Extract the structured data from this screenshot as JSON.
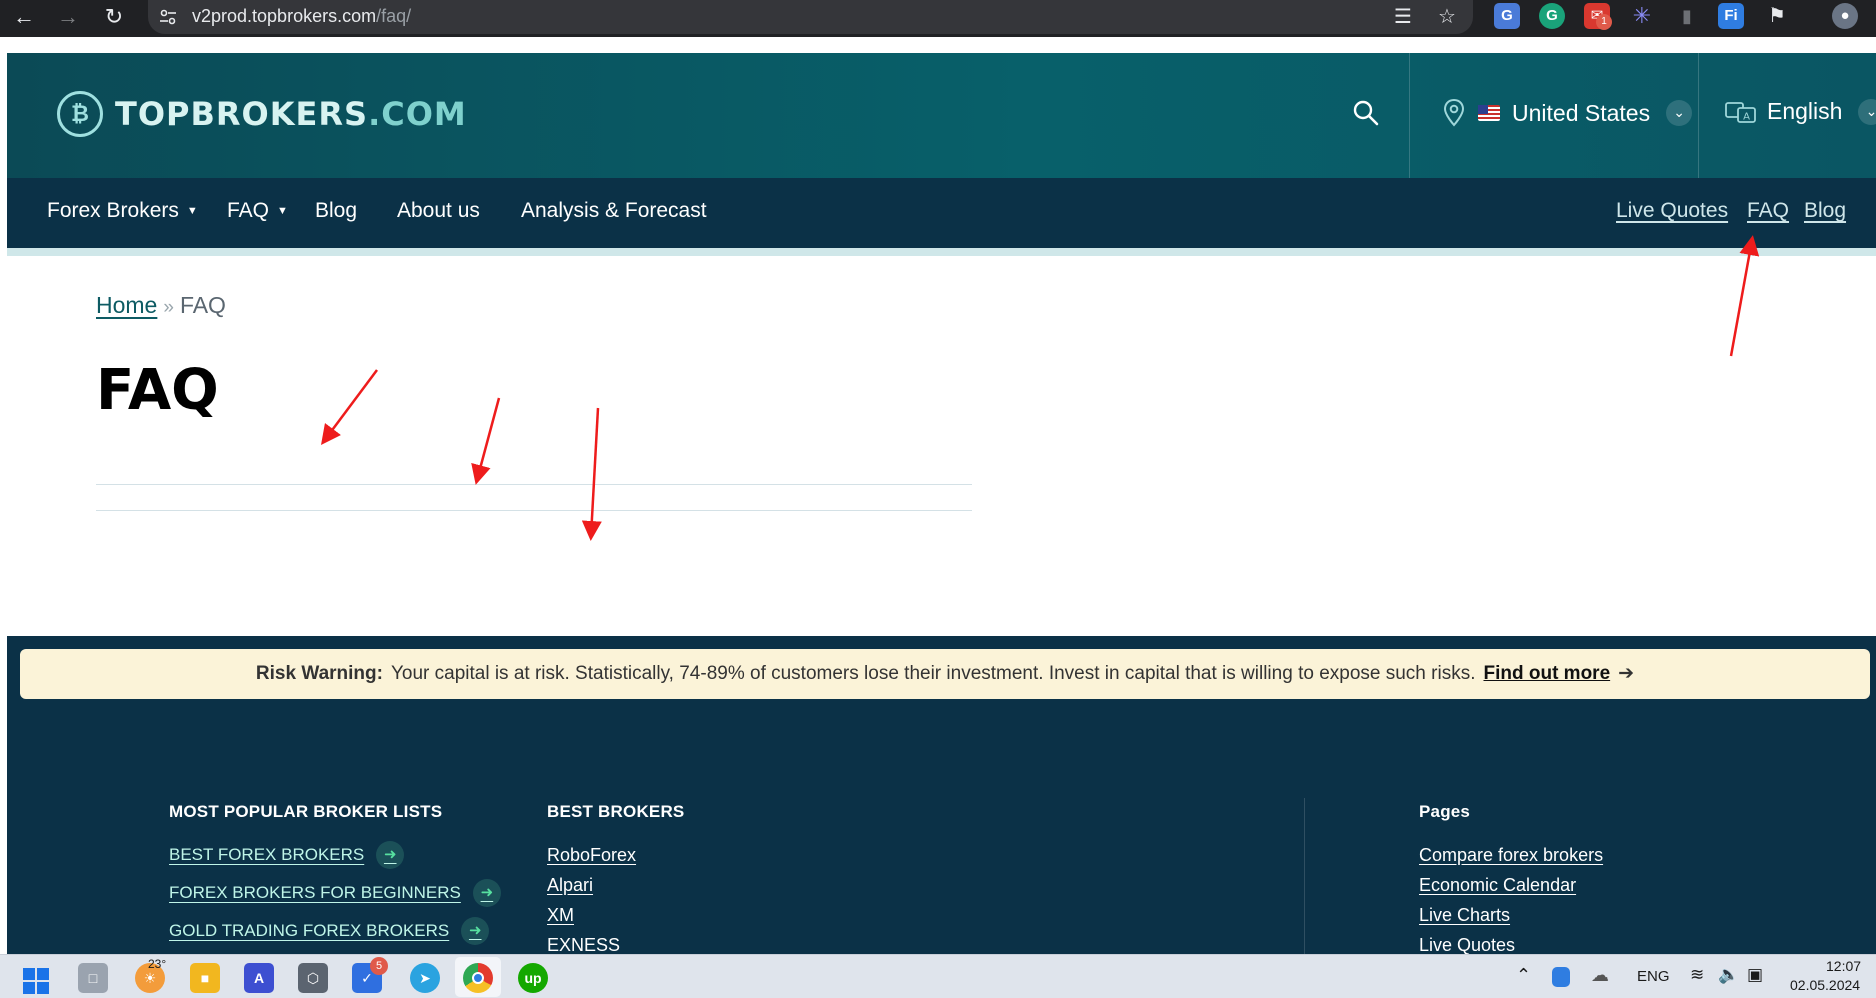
{
  "browser": {
    "url_host": "v2prod.topbrokers.com",
    "url_path": "/faq/",
    "extension_badge": "1"
  },
  "header": {
    "logo_mark": "₿",
    "logo_text_main": "TOPBROKERS",
    "logo_text_domain": ".COM",
    "country": "United States",
    "language": "English",
    "brand_color": "#0b4a56"
  },
  "nav": {
    "items": [
      {
        "label": "Forex Brokers",
        "has_dropdown": true
      },
      {
        "label": "FAQ",
        "has_dropdown": true
      },
      {
        "label": "Blog",
        "has_dropdown": false
      },
      {
        "label": "About us",
        "has_dropdown": false
      },
      {
        "label": "Analysis & Forecast",
        "has_dropdown": false
      }
    ],
    "right_links": [
      "Live Quotes",
      "FAQ",
      "Blog"
    ]
  },
  "breadcrumb": {
    "home": "Home",
    "separator": "»",
    "current": "FAQ"
  },
  "page": {
    "title": "FAQ"
  },
  "footer": {
    "risk": {
      "label": "Risk Warning:",
      "text": "Your capital is at risk. Statistically, 74-89% of customers lose their investment. Invest in capital that is willing to expose such risks.",
      "link": "Find out more",
      "arrow": "➔"
    },
    "popular": {
      "title": "MOST POPULAR BROKER LISTS",
      "items": [
        "BEST FOREX BROKERS",
        "FOREX BROKERS FOR BEGINNERS",
        "GOLD TRADING FOREX BROKERS"
      ]
    },
    "best": {
      "title": "BEST BROKERS",
      "items": [
        "RoboForex",
        "Alpari",
        "XM",
        "EXNESS"
      ]
    },
    "pages": {
      "title": "Pages",
      "items": [
        "Compare forex brokers",
        "Economic Calendar",
        "Live Charts",
        "Live Quotes"
      ]
    }
  },
  "taskbar": {
    "weather": "23°",
    "todo_badge": "5",
    "language": "ENG",
    "time": "12:07",
    "date": "02.05.2024"
  }
}
